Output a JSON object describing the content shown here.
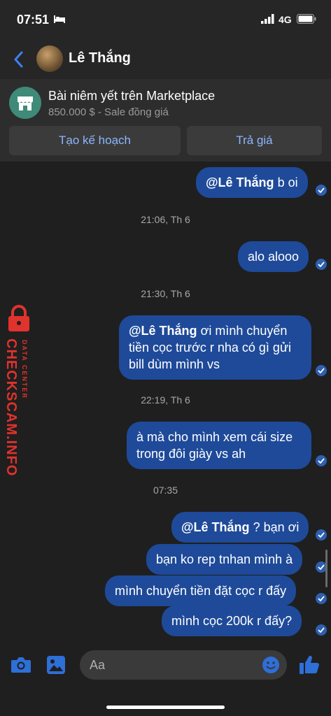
{
  "status_bar": {
    "time": "07:51",
    "network": "4G"
  },
  "header": {
    "contact_name": "Lê Thắng"
  },
  "marketplace": {
    "title": "Bài niêm yết trên Marketplace",
    "subtitle": "850.000 $ - Sale đồng giá",
    "plan_label": "Tạo kế hoạch",
    "offer_label": "Trả giá"
  },
  "messages": [
    {
      "mention": "@Lê Thắng",
      "text": " b oi"
    },
    {
      "timestamp": "21:06, Th 6"
    },
    {
      "text": "alo alooo"
    },
    {
      "timestamp": "21:30, Th 6"
    },
    {
      "mention": "@Lê Thắng",
      "line1": " ơi mình chuyển",
      "line2": "tiền cọc trước r nha có gì gửi",
      "line3": "bill dùm mình vs"
    },
    {
      "timestamp": "22:19, Th 6"
    },
    {
      "line1": "à mà cho mình xem cái size",
      "line2": "trong đôi giày vs ah"
    },
    {
      "timestamp": "07:35"
    },
    {
      "mention": "@Lê Thắng",
      "text": " ? bạn ơi"
    },
    {
      "text": "bạn ko rep tnhan mình à"
    },
    {
      "text": "mình chuyển tiền đặt cọc r đấy"
    },
    {
      "text": "mình cọc 200k r đấy?"
    }
  ],
  "watermark": {
    "brand": "CHECKSCAM.INFO",
    "tagline": "DATA CENTER"
  },
  "composer": {
    "placeholder": "Aa"
  },
  "colors": {
    "bubble": "#1e4a99",
    "accent": "#2e6fd8",
    "watermark": "#e0332d"
  }
}
